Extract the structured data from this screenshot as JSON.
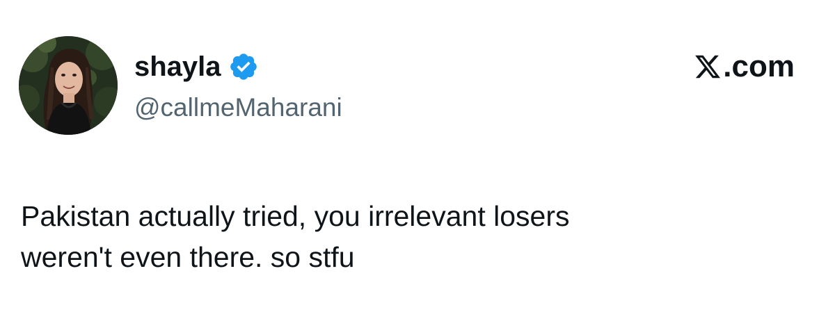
{
  "tweet": {
    "author": {
      "display_name": "shayla",
      "handle": "@callmeMaharani",
      "verified": true,
      "verified_icon": "verified-badge-icon",
      "verified_color": "#1d9bf0",
      "avatar_icon": "profile-avatar"
    },
    "brand": {
      "logo_icon": "x-logo-icon",
      "domain_suffix": ".com"
    },
    "text_line_1": "Pakistan actually tried, you irrelevant losers",
    "text_line_2": "weren't even there. so stfu"
  }
}
